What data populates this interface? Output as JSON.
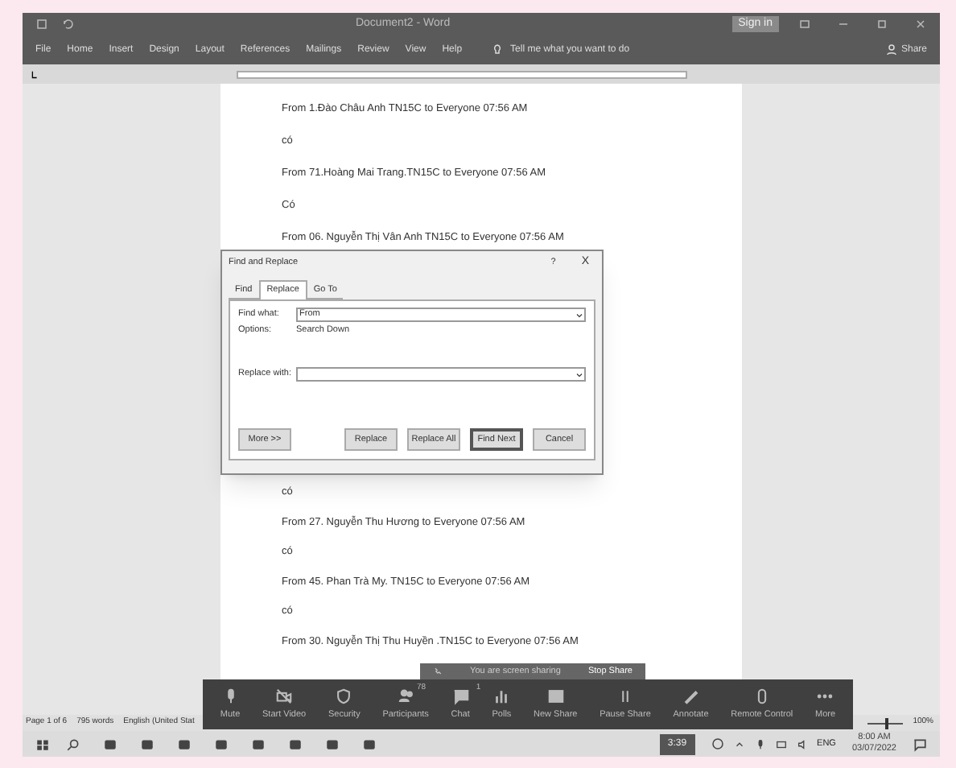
{
  "window": {
    "title": "Document2 - Word",
    "sign_in": "Sign in"
  },
  "ribbon": {
    "tabs": [
      "File",
      "Home",
      "Insert",
      "Design",
      "Layout",
      "References",
      "Mailings",
      "Review",
      "View",
      "Help"
    ],
    "tell_me": "Tell me what you want to do",
    "share": "Share"
  },
  "document": {
    "lines_top": [
      "From 1.Đào Châu Anh TN15C to Everyone 07:56 AM",
      "có",
      "From 71.Hoàng Mai Trang.TN15C to Everyone 07:56 AM",
      "Có",
      "From 06. Nguyễn Thị Vân Anh TN15C to Everyone 07:56 AM"
    ],
    "lines_bottom": [
      "có",
      "From 27. Nguyễn Thu Hương to Everyone 07:56 AM",
      "có",
      "From 45. Phan Trà My. TN15C to Everyone 07:56 AM",
      "có",
      "From 30. Nguyễn Thị Thu Huyền .TN15C to Everyone 07:56 AM"
    ]
  },
  "dialog": {
    "title": "Find and Replace",
    "help": "?",
    "close": "X",
    "tabs": [
      {
        "label": "Find",
        "selected": false
      },
      {
        "label": "Replace",
        "selected": true
      },
      {
        "label": "Go To",
        "selected": false
      }
    ],
    "find_what": {
      "label": "Find what:",
      "value": "From"
    },
    "options": {
      "label": "Options:",
      "value": "Search Down"
    },
    "replace_with": {
      "label": "Replace with:"
    },
    "more": "More >>",
    "buttons": [
      {
        "label": "Replace",
        "default": false
      },
      {
        "label": "Replace All",
        "default": false
      },
      {
        "label": "Find Next",
        "default": true
      },
      {
        "label": "Cancel",
        "default": false
      }
    ]
  },
  "status_bar": {
    "page": "Page 1 of 6",
    "words": "795 words",
    "language": "English (United Stat",
    "zoom": "100%",
    "zoom_slider": {
      "level": 0.55
    }
  },
  "zoom_toolbar": {
    "sharing": "You are screen sharing",
    "stop_share": "Stop Share",
    "controls": [
      {
        "label": "Mute",
        "kind": "mic"
      },
      {
        "label": "Start Video",
        "kind": "video"
      },
      {
        "label": "Security",
        "kind": "shield"
      },
      {
        "label": "Participants",
        "kind": "people",
        "count": "78"
      },
      {
        "label": "Chat",
        "kind": "chat",
        "count": "1"
      },
      {
        "label": "Polls",
        "kind": "polls"
      },
      {
        "label": "New Share",
        "kind": "share"
      },
      {
        "label": "Pause Share",
        "kind": "pause"
      },
      {
        "label": "Annotate",
        "kind": "pen"
      },
      {
        "label": "Remote Control",
        "kind": "mouse"
      },
      {
        "label": "More",
        "kind": "more"
      }
    ]
  },
  "taskbar": {
    "battery": "3:39",
    "lang": "ENG",
    "time": "8:00 AM",
    "date": "03/07/2022"
  }
}
